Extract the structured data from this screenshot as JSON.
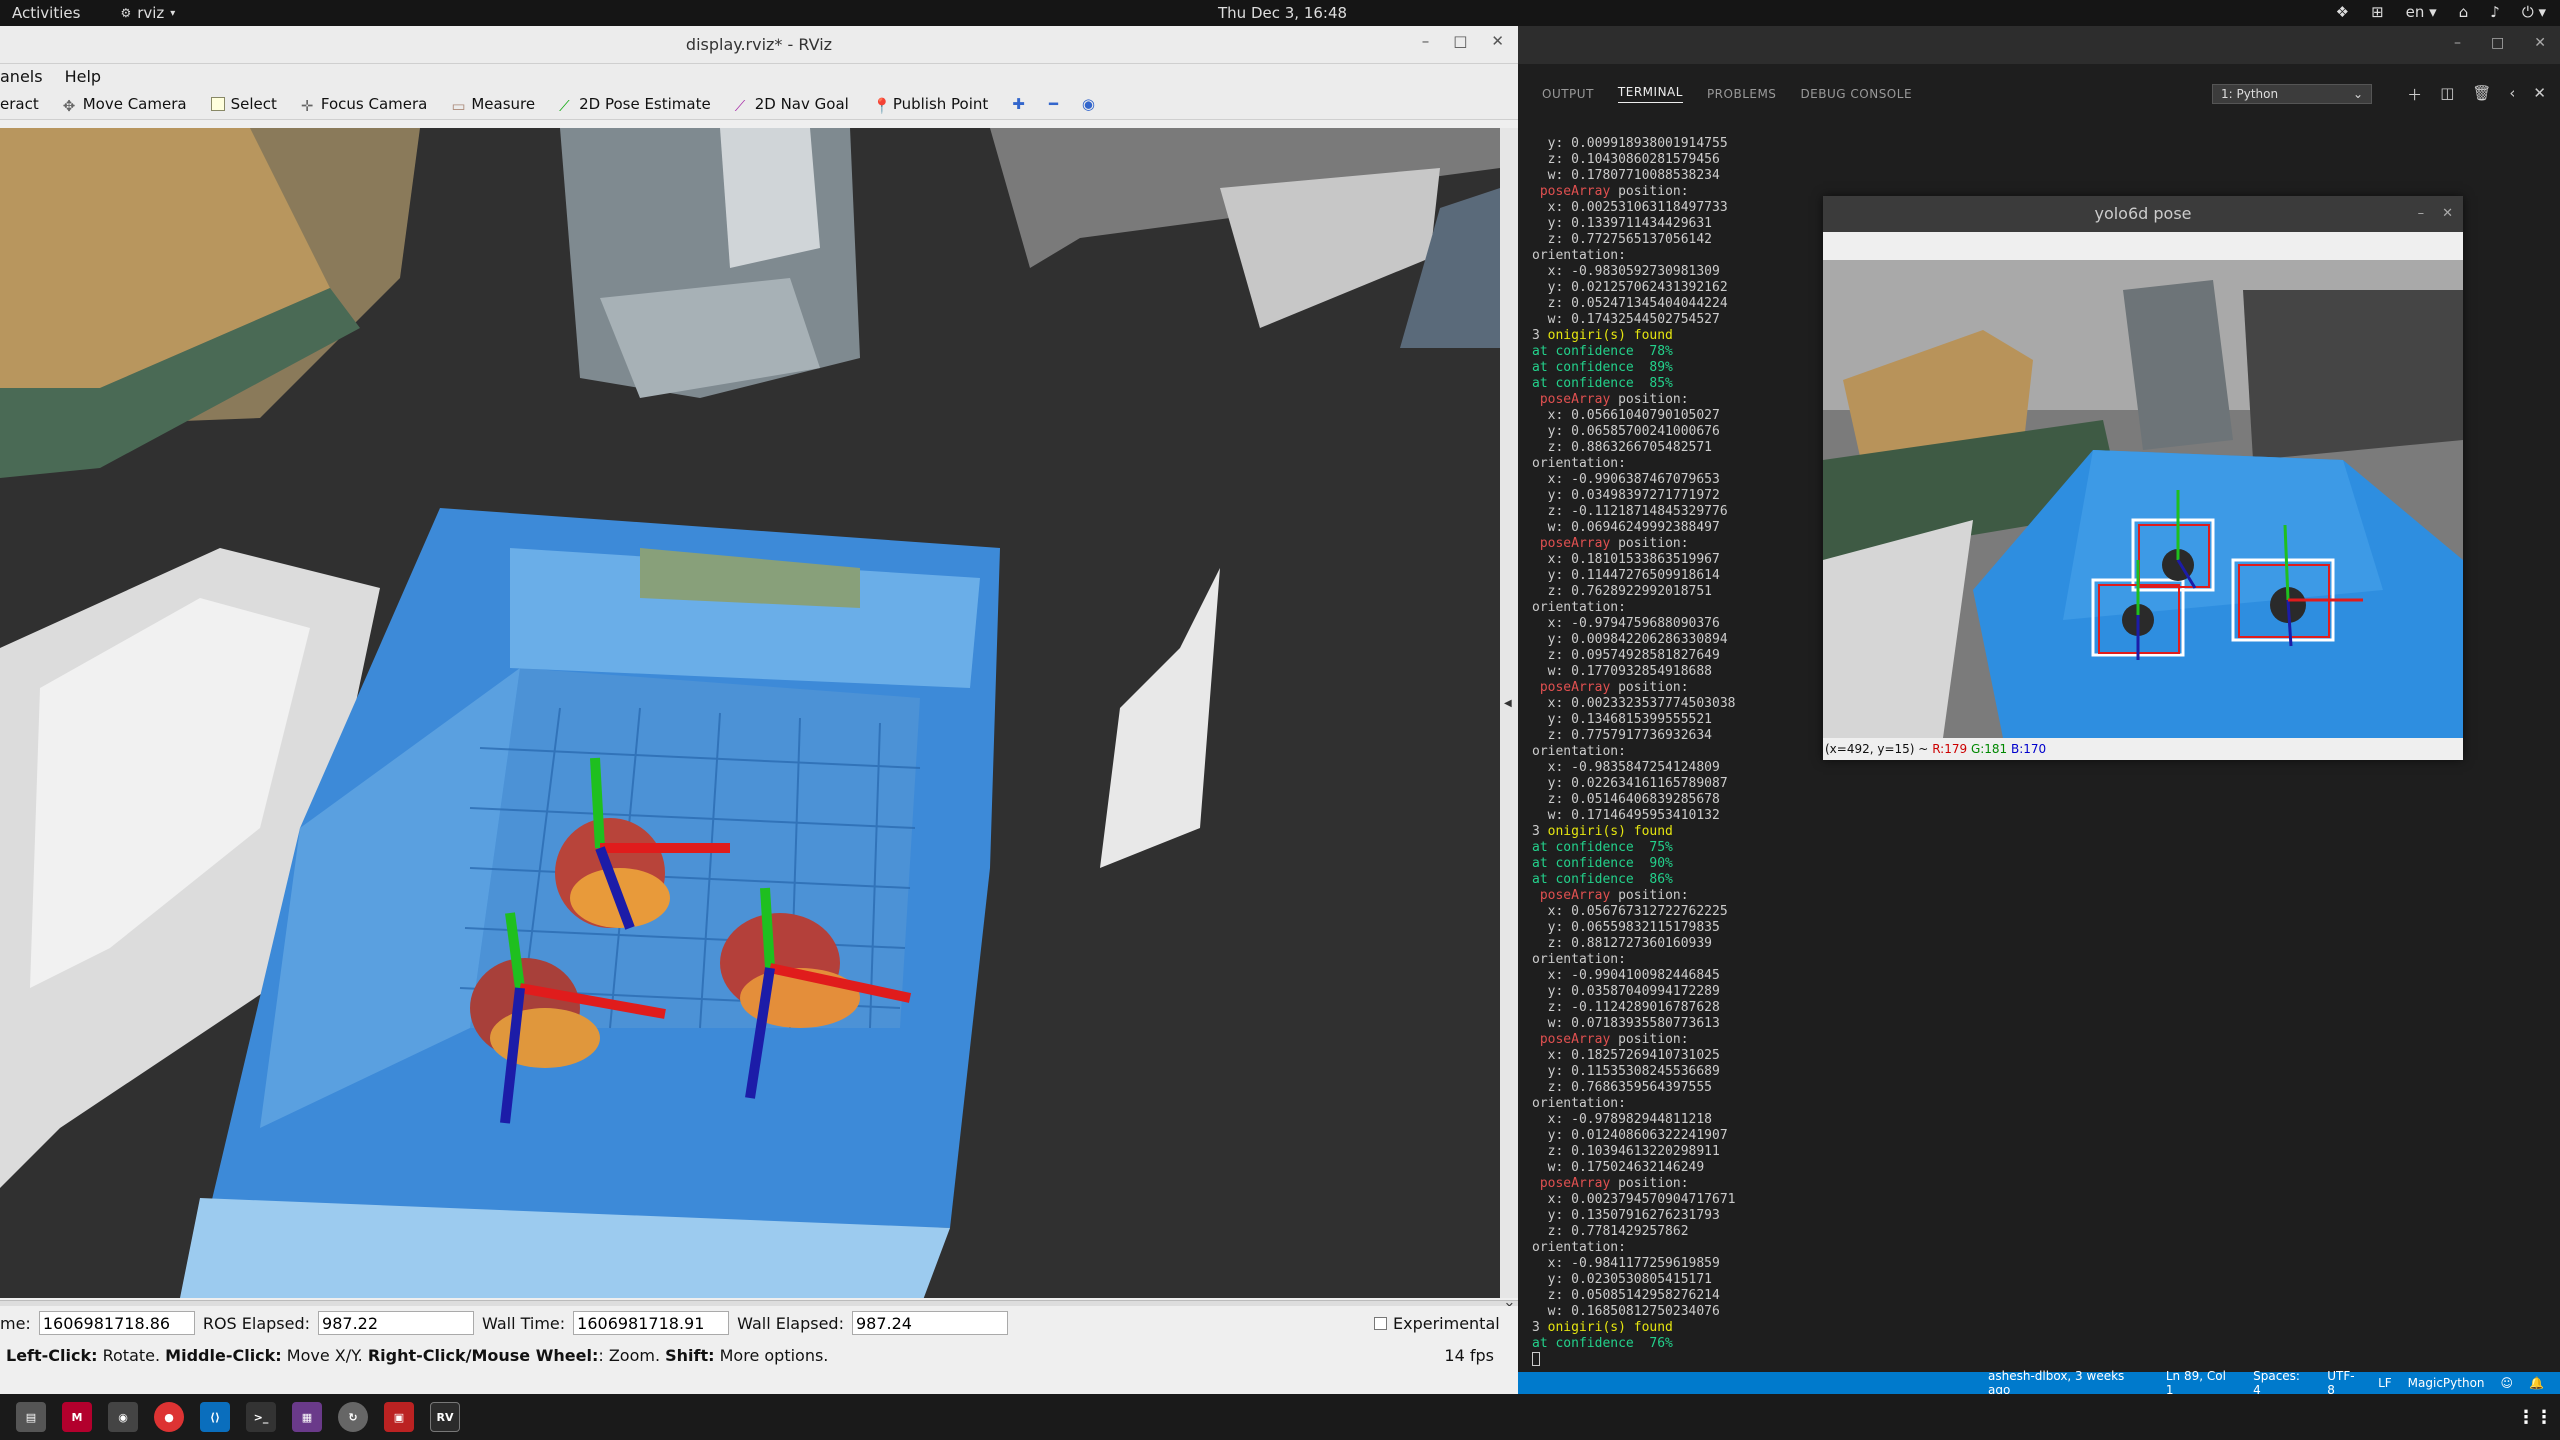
{
  "topbar": {
    "activities": "Activities",
    "app": "rviz",
    "clock": "Thu Dec  3, 16:48",
    "lang": "en"
  },
  "rviz": {
    "title": "display.rviz* - RViz",
    "menu": [
      "anels",
      "Help"
    ],
    "tools": [
      "eract",
      "Move Camera",
      "Select",
      "Focus Camera",
      "Measure",
      "2D Pose Estimate",
      "2D Nav Goal",
      "Publish Point"
    ],
    "time": {
      "ros_time_label": "me:",
      "ros_time": "1606981718.86",
      "ros_elapsed_label": "ROS Elapsed:",
      "ros_elapsed": "987.22",
      "wall_time_label": "Wall Time:",
      "wall_time": "1606981718.91",
      "wall_elapsed_label": "Wall Elapsed:",
      "wall_elapsed": "987.24",
      "experimental": "Experimental"
    },
    "status": {
      "b1": "Left-Click:",
      "t1": " Rotate. ",
      "b2": "Middle-Click:",
      "t2": " Move X/Y. ",
      "b3": "Right-Click/Mouse Wheel:",
      "t3": ": Zoom. ",
      "b4": "Shift:",
      "t4": " More options.",
      "fps": "14 fps"
    }
  },
  "vscode": {
    "tabs": [
      "OUTPUT",
      "TERMINAL",
      "PROBLEMS",
      "DEBUG CONSOLE"
    ],
    "terminal_select": "1: Python",
    "terminal_lines": [
      {
        "c": "",
        "t": "  y: 0.009918938001914755"
      },
      {
        "c": "",
        "t": "  z: 0.10430860281579456"
      },
      {
        "c": "",
        "t": "  w: 0.17807710088538234"
      },
      {
        "c": "t-red",
        "t": " poseArray",
        "r": " position:"
      },
      {
        "c": "",
        "t": "  x: 0.002531063118497733"
      },
      {
        "c": "",
        "t": "  y: 0.1339711434429631"
      },
      {
        "c": "",
        "t": "  z: 0.7727565137056142"
      },
      {
        "c": "",
        "t": "orientation:"
      },
      {
        "c": "",
        "t": "  x: -0.9830592730981309"
      },
      {
        "c": "",
        "t": "  y: 0.021257062431392162"
      },
      {
        "c": "",
        "t": "  z: 0.052471345404044224"
      },
      {
        "c": "",
        "t": "  w: 0.17432544502754527"
      },
      {
        "c": "t-yel",
        "p": "3 ",
        "t": "onigiri(s) found"
      },
      {
        "c": "t-grn",
        "t": "at confidence",
        "r": "  78%"
      },
      {
        "c": "t-grn",
        "t": "at confidence",
        "r": "  89%"
      },
      {
        "c": "t-grn",
        "t": "at confidence",
        "r": "  85%"
      },
      {
        "c": "t-red",
        "t": " poseArray",
        "r": " position:"
      },
      {
        "c": "",
        "t": "  x: 0.05661040790105027"
      },
      {
        "c": "",
        "t": "  y: 0.06585700241000676"
      },
      {
        "c": "",
        "t": "  z: 0.8863266705482571"
      },
      {
        "c": "",
        "t": "orientation:"
      },
      {
        "c": "",
        "t": "  x: -0.9906387467079653"
      },
      {
        "c": "",
        "t": "  y: 0.03498397271771972"
      },
      {
        "c": "",
        "t": "  z: -0.11218714845329776"
      },
      {
        "c": "",
        "t": "  w: 0.06946249992388497"
      },
      {
        "c": "t-red",
        "t": " poseArray",
        "r": " position:"
      },
      {
        "c": "",
        "t": "  x: 0.18101533863519967"
      },
      {
        "c": "",
        "t": "  y: 0.11447276509918614"
      },
      {
        "c": "",
        "t": "  z: 0.7628922992018751"
      },
      {
        "c": "",
        "t": "orientation:"
      },
      {
        "c": "",
        "t": "  x: -0.9794759688090376"
      },
      {
        "c": "",
        "t": "  y: 0.009842206286330894"
      },
      {
        "c": "",
        "t": "  z: 0.09574928581827649"
      },
      {
        "c": "",
        "t": "  w: 0.1770932854918688"
      },
      {
        "c": "t-red",
        "t": " poseArray",
        "r": " position:"
      },
      {
        "c": "",
        "t": "  x: 0.0023323537774503038"
      },
      {
        "c": "",
        "t": "  y: 0.1346815399555521"
      },
      {
        "c": "",
        "t": "  z: 0.7757917736932634"
      },
      {
        "c": "",
        "t": "orientation:"
      },
      {
        "c": "",
        "t": "  x: -0.9835847254124809"
      },
      {
        "c": "",
        "t": "  y: 0.022634161165789087"
      },
      {
        "c": "",
        "t": "  z: 0.05146406839285678"
      },
      {
        "c": "",
        "t": "  w: 0.17146495953410132"
      },
      {
        "c": "t-yel",
        "p": "3 ",
        "t": "onigiri(s) found"
      },
      {
        "c": "t-grn",
        "t": "at confidence",
        "r": "  75%"
      },
      {
        "c": "t-grn",
        "t": "at confidence",
        "r": "  90%"
      },
      {
        "c": "t-grn",
        "t": "at confidence",
        "r": "  86%"
      },
      {
        "c": "t-red",
        "t": " poseArray",
        "r": " position:"
      },
      {
        "c": "",
        "t": "  x: 0.056767312722762225"
      },
      {
        "c": "",
        "t": "  y: 0.06559832115179835"
      },
      {
        "c": "",
        "t": "  z: 0.8812727360160939"
      },
      {
        "c": "",
        "t": "orientation:"
      },
      {
        "c": "",
        "t": "  x: -0.9904100982446845"
      },
      {
        "c": "",
        "t": "  y: 0.03587040994172289"
      },
      {
        "c": "",
        "t": "  z: -0.1124289016787628"
      },
      {
        "c": "",
        "t": "  w: 0.07183935580773613"
      },
      {
        "c": "t-red",
        "t": " poseArray",
        "r": " position:"
      },
      {
        "c": "",
        "t": "  x: 0.18257269410731025"
      },
      {
        "c": "",
        "t": "  y: 0.11535308245536689"
      },
      {
        "c": "",
        "t": "  z: 0.7686359564397555"
      },
      {
        "c": "",
        "t": "orientation:"
      },
      {
        "c": "",
        "t": "  x: -0.978982944811218"
      },
      {
        "c": "",
        "t": "  y: 0.012408606322241907"
      },
      {
        "c": "",
        "t": "  z: 0.10394613220298911"
      },
      {
        "c": "",
        "t": "  w: 0.175024632146249"
      },
      {
        "c": "t-red",
        "t": " poseArray",
        "r": " position:"
      },
      {
        "c": "",
        "t": "  x: 0.0023794570904717671"
      },
      {
        "c": "",
        "t": "  y: 0.13507916276231793"
      },
      {
        "c": "",
        "t": "  z: 0.7781429257862"
      },
      {
        "c": "",
        "t": "orientation:"
      },
      {
        "c": "",
        "t": "  x: -0.9841177259619859"
      },
      {
        "c": "",
        "t": "  y: 0.0230530805415171"
      },
      {
        "c": "",
        "t": "  z: 0.05085142958276214"
      },
      {
        "c": "",
        "t": "  w: 0.16850812750234076"
      },
      {
        "c": "t-yel",
        "p": "3 ",
        "t": "onigiri(s) found"
      },
      {
        "c": "t-grn",
        "t": "at confidence",
        "r": "  76%"
      }
    ],
    "statusbar": [
      "ashesh-dlbox, 3 weeks ago",
      "Ln 89, Col 1",
      "Spaces: 4",
      "UTF-8",
      "LF",
      "MagicPython"
    ]
  },
  "popup": {
    "title": "yolo6d pose",
    "pixel_info": "(x=492, y=15) ~",
    "r": "R:179",
    "g": "G:181",
    "b": "B:170"
  }
}
